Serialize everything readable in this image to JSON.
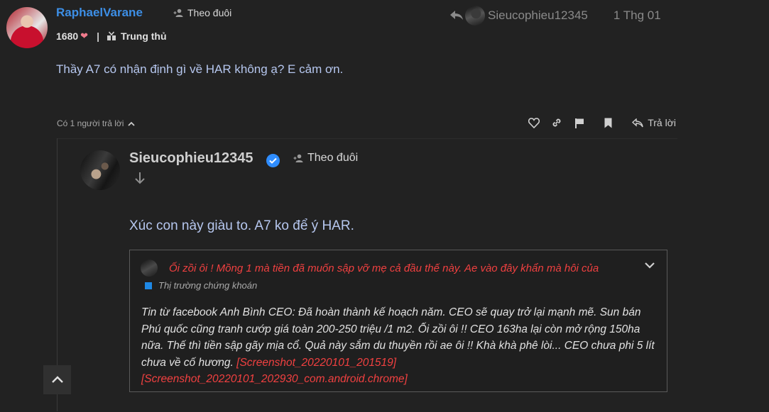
{
  "post": {
    "username": "RaphaelVarane",
    "follow_label": "Theo đuôi",
    "likes": "1680",
    "badge": "Trung thủ",
    "reply_to_user": "Sieucophieu12345",
    "date": "1 Thg 01",
    "content": "Thầy A7 có nhận định gì về HAR không ạ? E cảm ơn.",
    "replies_count": "Có 1 người trả lời",
    "reply_label": "Trả lời"
  },
  "reply": {
    "username": "Sieucophieu12345",
    "follow_label": "Theo đuôi",
    "content": "Xúc con này giàu to. A7 ko để ý HAR.",
    "quote": {
      "title": "Ối zồi ôi ! Mồng 1 mà tiền đã muốn sập vỡ mẹ cả đầu thế này. Ae vào đây khẩn mà hôi của",
      "category": "Thị trường chứng khoán",
      "category_color": "#1e88e5",
      "body": "Tin từ facebook Anh Bình CEO: Đã hoàn thành kế hoạch năm. CEO sẽ quay trở lại mạnh mẽ. Sun bán Phú quốc cũng tranh cướp giá toàn 200-250 triệu /1 m2. Ối zồi ôi !! CEO 163ha lại còn mở rộng 150ha nữa. Thế thì tiền sập gãy mịa cổ. Quả này sắm du thuyền rồi ae ôi !! Khà khà phê lòi... CEO chưa phi 5 lít chưa về cố hương.",
      "link1": "[Screenshot_20220101_201519]",
      "link2": "[Screenshot_20220101_202930_com.android.chrome]"
    }
  },
  "colors": {
    "background": "#222222",
    "username": "#3d8fe6",
    "content_text": "#b6c7ef",
    "quote_title": "#f04040",
    "verified": "#2f8dff"
  }
}
